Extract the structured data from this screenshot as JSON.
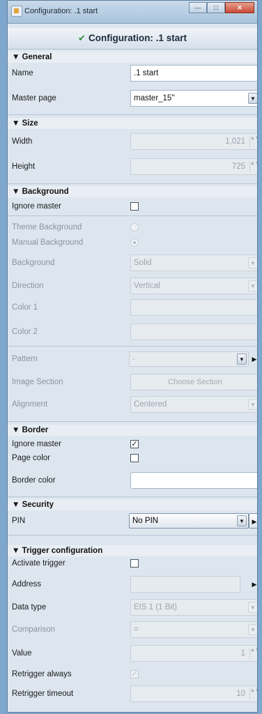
{
  "window": {
    "title": "Configuration: .1 start",
    "min": "—",
    "max": "□",
    "close": "✕"
  },
  "header": {
    "title": "Configuration: .1 start"
  },
  "general": {
    "heading": "▼ General",
    "name_label": "Name",
    "name_value": ".1 start",
    "master_label": "Master page",
    "master_value": "master_15\""
  },
  "size": {
    "heading": "▼ Size",
    "width_label": "Width",
    "width_value": "1,021",
    "height_label": "Height",
    "height_value": "725"
  },
  "background": {
    "heading": "▼ Background",
    "ignore_master": "Ignore master",
    "theme_bg": "Theme Background",
    "manual_bg": "Manual Background",
    "bg_label": "Background",
    "bg_value": "Solid",
    "direction_label": "Direction",
    "direction_value": "Vertical",
    "color1_label": "Color 1",
    "color2_label": "Color 2",
    "pattern_label": "Pattern",
    "pattern_value": "-",
    "image_section_label": "Image Section",
    "image_section_button": "Choose Section",
    "alignment_label": "Alignment",
    "alignment_value": "Centered"
  },
  "border": {
    "heading": "▼ Border",
    "ignore_master": "Ignore master",
    "page_color": "Page color",
    "border_color": "Border color"
  },
  "security": {
    "heading": "▼ Security",
    "pin_label": "PIN",
    "pin_value": "No PIN"
  },
  "trigger": {
    "heading": "▼ Trigger configuration",
    "activate": "Activate trigger",
    "address": "Address",
    "data_type_label": "Data type",
    "data_type_value": "EIS 1 (1 Bit)",
    "comparison_label": "Comparison",
    "comparison_value": "=",
    "value_label": "Value",
    "value_value": "1",
    "retrigger_always": "Retrigger always",
    "retrigger_timeout_label": "Retrigger timeout",
    "retrigger_timeout_value": "10"
  },
  "icons": {
    "check": "✓",
    "spin": "▲▼",
    "combo": "▼",
    "right_arrow": "▶"
  }
}
